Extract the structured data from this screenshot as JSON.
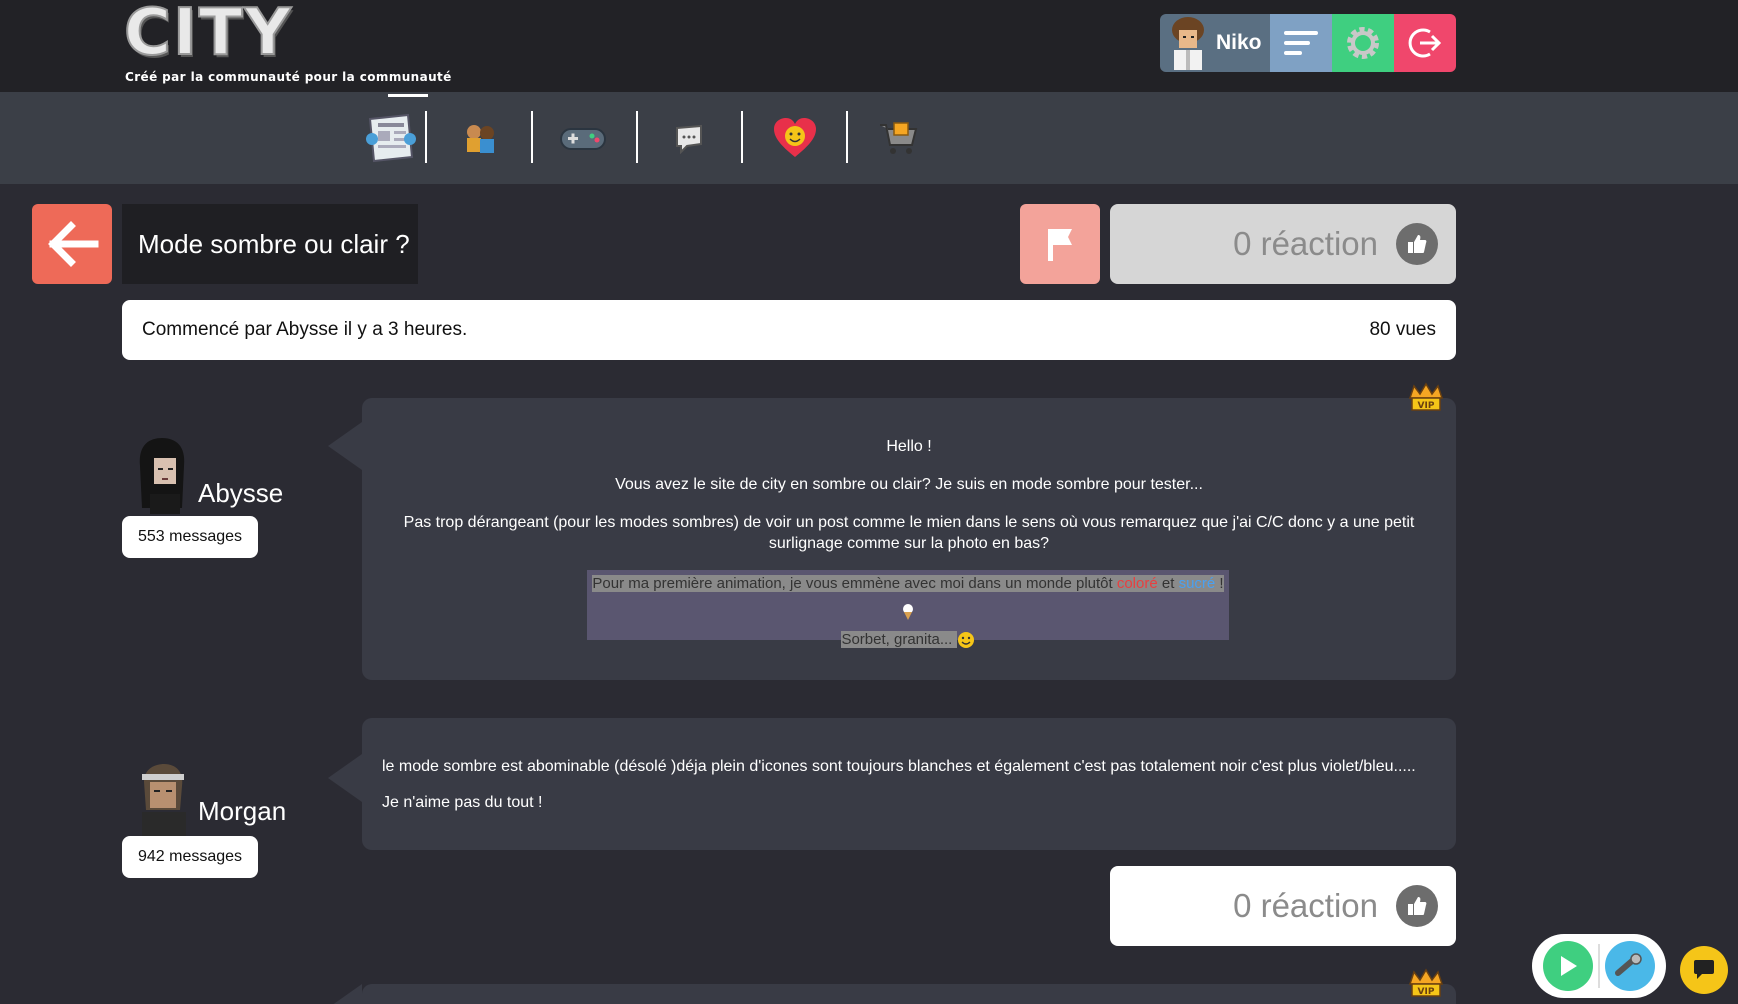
{
  "header": {
    "logo_text": "CITY",
    "tagline": "Créé par la communauté pour la communauté",
    "user_name": "Niko"
  },
  "topic": {
    "title": "Mode sombre ou clair ?",
    "started": "Commencé par Abysse il y a 3 heures.",
    "views": "80 vues",
    "reactions": "0 réaction"
  },
  "posts": [
    {
      "author": "Abysse",
      "messages": "553 messages",
      "lines": [
        "Hello !",
        "Vous avez le site de city en sombre ou clair? Je suis en mode sombre pour tester...",
        "Pas trop dérangeant (pour les modes sombres) de voir un post comme le mien dans le sens où vous remarquez que j'ai C/C donc y a une petit surlignage comme sur la photo en bas?"
      ],
      "quote": {
        "prefix": "Pour ma première animation, je vous emmène avec moi dans un monde plutôt ",
        "word1": "coloré",
        "middle": " et ",
        "word2": "sucré",
        "suffix": " ! ",
        "line2": "Sorbet, granita... "
      }
    },
    {
      "author": "Morgan",
      "messages": "942 messages",
      "lines": [
        "le mode sombre est abominable (désolé )déja plein d'icones sont toujours blanches et également c'est pas totalement noir c'est plus violet/bleu.....",
        "Je n'aime pas du tout !"
      ],
      "reactions": "0 réaction"
    }
  ],
  "colors": {
    "background": "#2b2b33",
    "topbar": "#222226",
    "nav": "#3b3f47",
    "accent_back": "#ee6a58",
    "accent_flag": "#f3a39a"
  }
}
